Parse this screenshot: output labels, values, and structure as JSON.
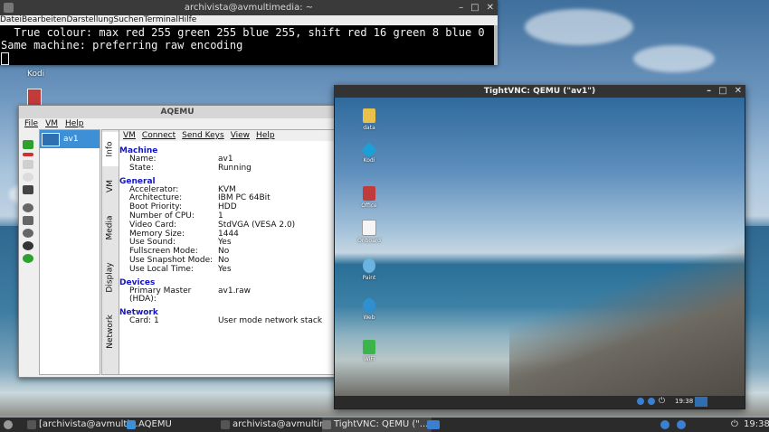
{
  "terminal": {
    "title": "archivista@avmultimedia: ~",
    "menu": "DateiBearbeitenDarstellungSuchenTerminalHilfe",
    "lines": [
      "  True colour: max red 255 green 255 blue 255, shift red 16 green 8 blue 0",
      "Same machine: preferring raw encoding"
    ]
  },
  "desktop": {
    "kodi_label": "Kodi"
  },
  "aqemu": {
    "title": "AQEMU",
    "menu": [
      "File",
      "VM",
      "Help"
    ],
    "vm_name": "av1",
    "tabs": [
      "Info",
      "VM",
      "Media",
      "Display",
      "Network"
    ],
    "panel_menu": [
      "VM",
      "Connect",
      "Send Keys",
      "View",
      "Help"
    ],
    "sections": [
      {
        "heading": "Machine",
        "rows": [
          [
            "Name:",
            "av1"
          ],
          [
            "State:",
            "Running"
          ]
        ]
      },
      {
        "heading": "General",
        "rows": [
          [
            "Accelerator:",
            "KVM"
          ],
          [
            "Architecture:",
            "IBM PC 64Bit"
          ],
          [
            "Boot Priority:",
            "HDD"
          ],
          [
            "Number of CPU:",
            "1"
          ],
          [
            "Video Card:",
            "StdVGA (VESA 2.0)"
          ],
          [
            "Memory Size:",
            "1444"
          ],
          [
            "Use Sound:",
            "Yes"
          ],
          [
            "Fullscreen Mode:",
            "No"
          ],
          [
            "Use Snapshot Mode:",
            "No"
          ],
          [
            "Use Local Time:",
            "Yes"
          ]
        ]
      },
      {
        "heading": "Devices",
        "rows": [
          [
            "Primary Master (HDA):",
            "av1.raw"
          ]
        ]
      },
      {
        "heading": "Network",
        "rows": [
          [
            "Card: 1",
            "User mode network stack"
          ]
        ]
      }
    ]
  },
  "vnc": {
    "title": "TightVNC: QEMU (\"av1\")",
    "icons": [
      "data",
      "Kodi",
      "Office",
      "Onboard",
      "Paint",
      "Web",
      "WiFi"
    ],
    "clock": "19:38"
  },
  "taskbar": {
    "items": [
      "[archivista@avmulti...",
      "AQEMU",
      "archivista@avmultim...",
      "TightVNC: QEMU (\"..."
    ],
    "clock": "19:38"
  },
  "colors": {
    "accent": "#3d8fd6",
    "section_heading": "#1414c8",
    "taskbar": "#2b2b2b"
  }
}
